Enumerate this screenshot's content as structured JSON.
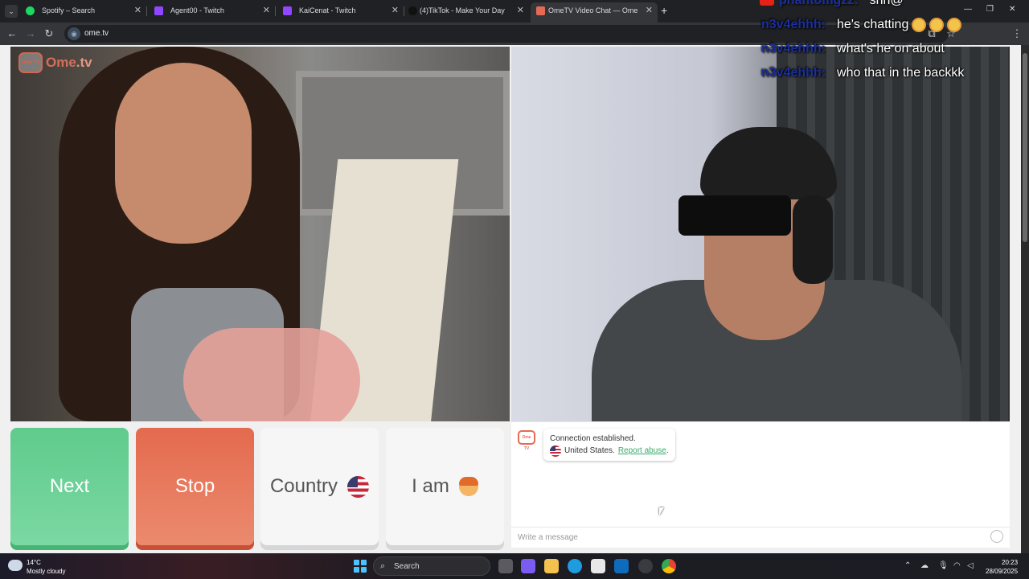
{
  "browser": {
    "tabs": [
      {
        "title": "Spotify – Search",
        "color": "#1ed760"
      },
      {
        "title": "Agent00 - Twitch",
        "color": "#9146ff"
      },
      {
        "title": "KaiCenat - Twitch",
        "color": "#9146ff"
      },
      {
        "title": "(4)TikTok - Make Your Day",
        "color": "#111111"
      },
      {
        "title": "OmeTV Video Chat — Ome",
        "color": "#e56a55"
      }
    ],
    "new_tab": "+",
    "url": "ome.tv"
  },
  "logo": {
    "brand": "Ome",
    "tld": ".tv",
    "mark": "Ome TV"
  },
  "buttons": {
    "next": "Next",
    "stop": "Stop",
    "country": "Country",
    "i_am": "I am"
  },
  "chat": {
    "status": "Connection established.",
    "country": "United States.",
    "report": "Report abuse",
    "report_suffix": ".",
    "placeholder": "Write a message"
  },
  "stream_overlay": {
    "top_partial": {
      "user": "phantomgzz:",
      "message": "shh@"
    },
    "messages": [
      {
        "user": "n3v4ehhh:",
        "message": "he's chatting"
      },
      {
        "user": "n3v4ehhh:",
        "message": "what's he on about"
      },
      {
        "user": "n3v4ehhh:",
        "message": "who that in the backkk"
      }
    ]
  },
  "taskbar": {
    "temperature": "14°C",
    "weather": "Mostly cloudy",
    "search": "Search",
    "time": "20:23",
    "date": "28/09/2025"
  },
  "colors": {
    "next": "#5fcb8c",
    "stop": "#e46a4e",
    "brand": "#e56a55",
    "link": "#3bab6b"
  }
}
